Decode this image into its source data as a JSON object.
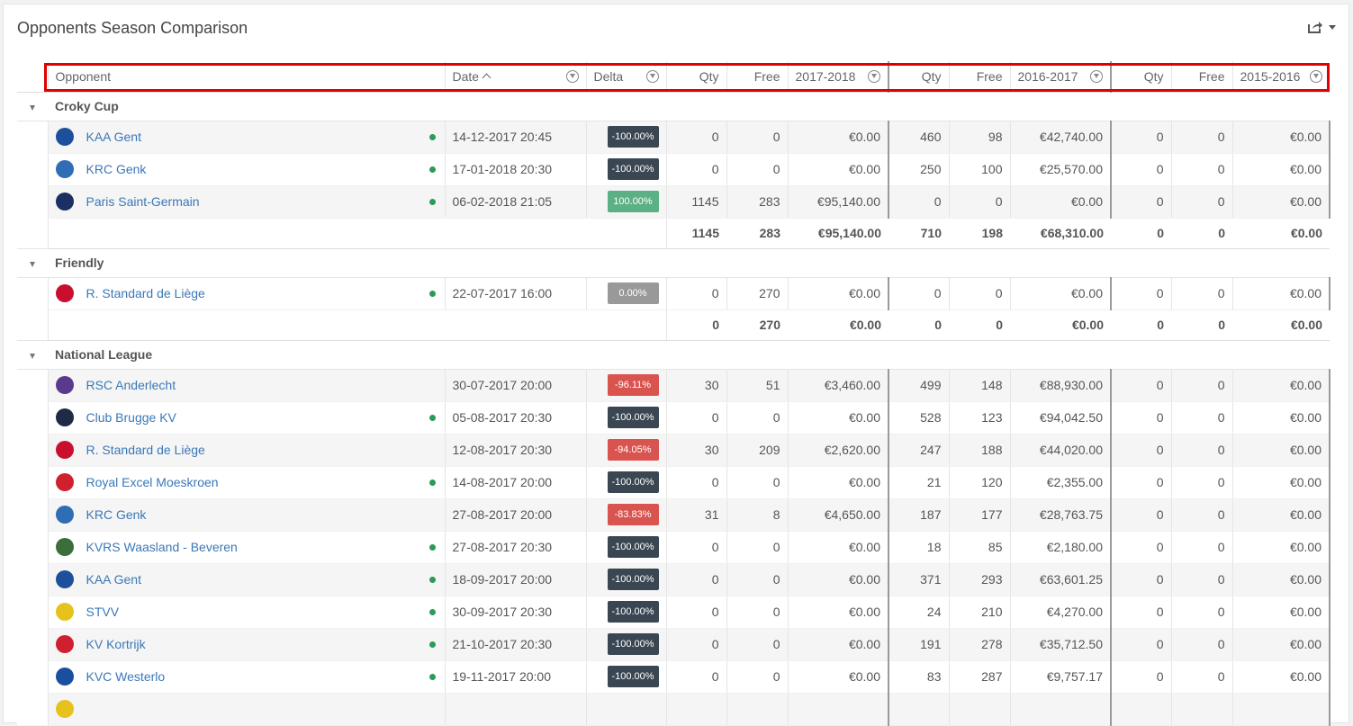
{
  "title": "Opponents Season Comparison",
  "colors": {
    "accent_link": "#3a78b8",
    "delta_neg100": "#3a4652",
    "delta_pos": "#5cb085",
    "delta_neutral": "#999999",
    "delta_neg": "#d9534f",
    "highlight": "#e00000",
    "status_dot": "#2e9a57"
  },
  "columns": {
    "opponent": "Opponent",
    "date": "Date",
    "delta": "Delta",
    "qty": "Qty",
    "free": "Free",
    "season1": "2017-2018",
    "season2": "2016-2017",
    "season3": "2015-2016"
  },
  "groups": [
    {
      "name": "Croky Cup",
      "rows": [
        {
          "opponent": "KAA Gent",
          "logo": "#1d4f9c",
          "dot": true,
          "date": "14-12-2017 20:45",
          "delta": "-100.00%",
          "delta_type": "neg100",
          "q1": "0",
          "f1": "0",
          "a1": "€0.00",
          "q2": "460",
          "f2": "98",
          "a2": "€42,740.00",
          "q3": "0",
          "f3": "0",
          "a3": "€0.00"
        },
        {
          "opponent": "KRC Genk",
          "logo": "#2f6db5",
          "dot": true,
          "date": "17-01-2018 20:30",
          "delta": "-100.00%",
          "delta_type": "neg100",
          "q1": "0",
          "f1": "0",
          "a1": "€0.00",
          "q2": "250",
          "f2": "100",
          "a2": "€25,570.00",
          "q3": "0",
          "f3": "0",
          "a3": "€0.00"
        },
        {
          "opponent": "Paris Saint-Germain",
          "logo": "#1c2f63",
          "dot": true,
          "date": "06-02-2018 21:05",
          "delta": "100.00%",
          "delta_type": "pos",
          "q1": "1145",
          "f1": "283",
          "a1": "€95,140.00",
          "q2": "0",
          "f2": "0",
          "a2": "€0.00",
          "q3": "0",
          "f3": "0",
          "a3": "€0.00"
        }
      ],
      "total": {
        "q1": "1145",
        "f1": "283",
        "a1": "€95,140.00",
        "q2": "710",
        "f2": "198",
        "a2": "€68,310.00",
        "q3": "0",
        "f3": "0",
        "a3": "€0.00"
      }
    },
    {
      "name": "Friendly",
      "rows": [
        {
          "opponent": "R. Standard de Liège",
          "logo": "#c8102e",
          "dot": true,
          "date": "22-07-2017 16:00",
          "delta": "0.00%",
          "delta_type": "neu",
          "q1": "0",
          "f1": "270",
          "a1": "€0.00",
          "q2": "0",
          "f2": "0",
          "a2": "€0.00",
          "q3": "0",
          "f3": "0",
          "a3": "€0.00"
        }
      ],
      "total": {
        "q1": "0",
        "f1": "270",
        "a1": "€0.00",
        "q2": "0",
        "f2": "0",
        "a2": "€0.00",
        "q3": "0",
        "f3": "0",
        "a3": "€0.00"
      }
    },
    {
      "name": "National League",
      "rows": [
        {
          "opponent": "RSC Anderlecht",
          "logo": "#5b3a8e",
          "dot": false,
          "date": "30-07-2017 20:00",
          "delta": "-96.11%",
          "delta_type": "negp",
          "q1": "30",
          "f1": "51",
          "a1": "€3,460.00",
          "q2": "499",
          "f2": "148",
          "a2": "€88,930.00",
          "q3": "0",
          "f3": "0",
          "a3": "€0.00"
        },
        {
          "opponent": "Club Brugge KV",
          "logo": "#1f2a44",
          "dot": true,
          "date": "05-08-2017 20:30",
          "delta": "-100.00%",
          "delta_type": "neg100",
          "q1": "0",
          "f1": "0",
          "a1": "€0.00",
          "q2": "528",
          "f2": "123",
          "a2": "€94,042.50",
          "q3": "0",
          "f3": "0",
          "a3": "€0.00"
        },
        {
          "opponent": "R. Standard de Liège",
          "logo": "#c8102e",
          "dot": false,
          "date": "12-08-2017 20:30",
          "delta": "-94.05%",
          "delta_type": "negp",
          "q1": "30",
          "f1": "209",
          "a1": "€2,620.00",
          "q2": "247",
          "f2": "188",
          "a2": "€44,020.00",
          "q3": "0",
          "f3": "0",
          "a3": "€0.00"
        },
        {
          "opponent": "Royal Excel Moeskroen",
          "logo": "#d0202f",
          "dot": true,
          "date": "14-08-2017 20:00",
          "delta": "-100.00%",
          "delta_type": "neg100",
          "q1": "0",
          "f1": "0",
          "a1": "€0.00",
          "q2": "21",
          "f2": "120",
          "a2": "€2,355.00",
          "q3": "0",
          "f3": "0",
          "a3": "€0.00"
        },
        {
          "opponent": "KRC Genk",
          "logo": "#2f6db5",
          "dot": false,
          "date": "27-08-2017 20:00",
          "delta": "-83.83%",
          "delta_type": "negp",
          "q1": "31",
          "f1": "8",
          "a1": "€4,650.00",
          "q2": "187",
          "f2": "177",
          "a2": "€28,763.75",
          "q3": "0",
          "f3": "0",
          "a3": "€0.00"
        },
        {
          "opponent": "KVRS Waasland - Beveren",
          "logo": "#3b6e3b",
          "dot": true,
          "date": "27-08-2017 20:30",
          "delta": "-100.00%",
          "delta_type": "neg100",
          "q1": "0",
          "f1": "0",
          "a1": "€0.00",
          "q2": "18",
          "f2": "85",
          "a2": "€2,180.00",
          "q3": "0",
          "f3": "0",
          "a3": "€0.00"
        },
        {
          "opponent": "KAA Gent",
          "logo": "#1d4f9c",
          "dot": true,
          "date": "18-09-2017 20:00",
          "delta": "-100.00%",
          "delta_type": "neg100",
          "q1": "0",
          "f1": "0",
          "a1": "€0.00",
          "q2": "371",
          "f2": "293",
          "a2": "€63,601.25",
          "q3": "0",
          "f3": "0",
          "a3": "€0.00"
        },
        {
          "opponent": "STVV",
          "logo": "#e8c21c",
          "dot": true,
          "date": "30-09-2017 20:30",
          "delta": "-100.00%",
          "delta_type": "neg100",
          "q1": "0",
          "f1": "0",
          "a1": "€0.00",
          "q2": "24",
          "f2": "210",
          "a2": "€4,270.00",
          "q3": "0",
          "f3": "0",
          "a3": "€0.00"
        },
        {
          "opponent": "KV Kortrijk",
          "logo": "#d01f2f",
          "dot": true,
          "date": "21-10-2017 20:30",
          "delta": "-100.00%",
          "delta_type": "neg100",
          "q1": "0",
          "f1": "0",
          "a1": "€0.00",
          "q2": "191",
          "f2": "278",
          "a2": "€35,712.50",
          "q3": "0",
          "f3": "0",
          "a3": "€0.00"
        },
        {
          "opponent": "KVC Westerlo",
          "logo": "#1a4fa0",
          "dot": true,
          "date": "19-11-2017 20:00",
          "delta": "-100.00%",
          "delta_type": "neg100",
          "q1": "0",
          "f1": "0",
          "a1": "€0.00",
          "q2": "83",
          "f2": "287",
          "a2": "€9,757.17",
          "q3": "0",
          "f3": "0",
          "a3": "€0.00"
        },
        {
          "opponent": "",
          "logo": "#e8c21c",
          "dot": false,
          "date": "",
          "delta": "",
          "delta_type": "neg100",
          "q1": "",
          "f1": "",
          "a1": "",
          "q2": "",
          "f2": "",
          "a2": "",
          "q3": "",
          "f3": "",
          "a3": ""
        }
      ]
    }
  ]
}
